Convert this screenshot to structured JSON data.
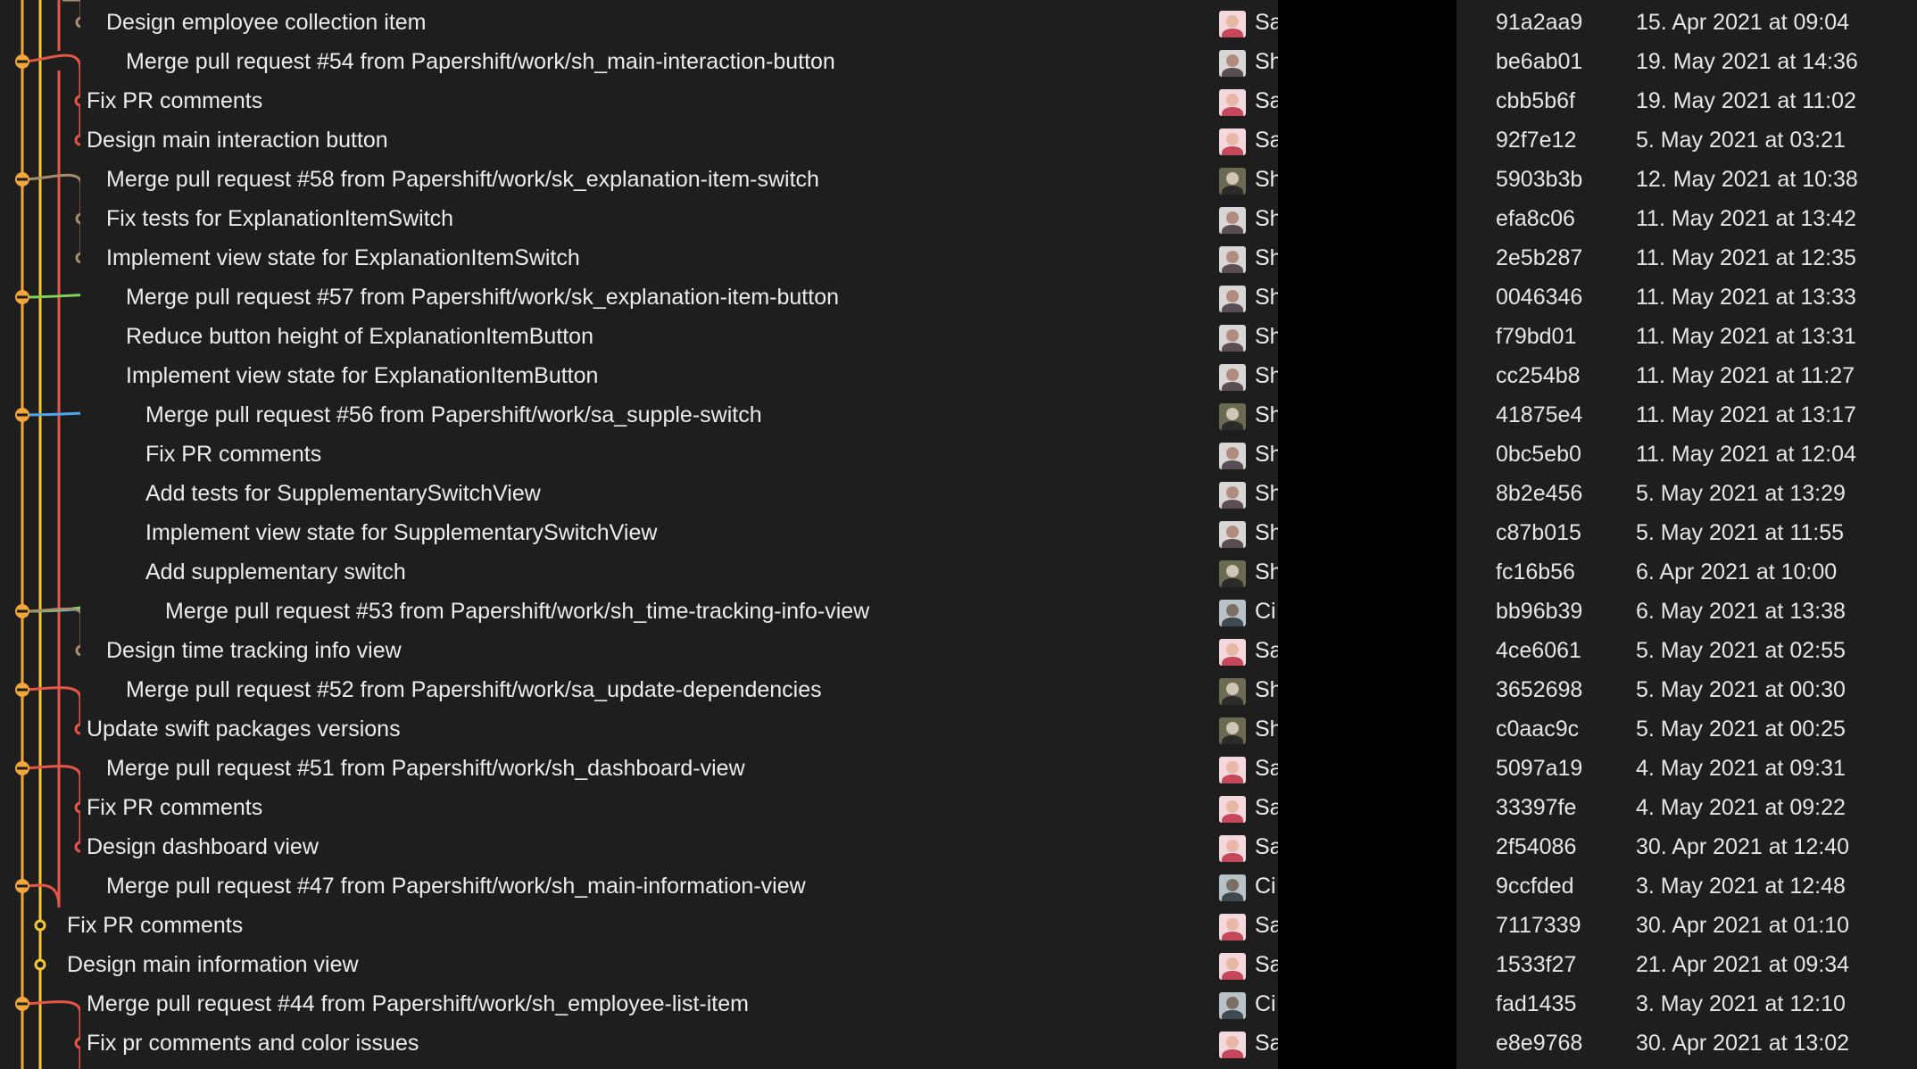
{
  "colors": {
    "background": "#1e1e1e",
    "main_branch": "#f5a63a",
    "lane_yellow": "#f3c833",
    "lane_red": "#e85445",
    "lane_tan": "#a88c6c",
    "lane_green": "#7fd55a",
    "lane_blue": "#4ea6f0"
  },
  "commits": [
    {
      "message": "Design employee collection item",
      "avatar": "sa",
      "author": "Sa",
      "hash": "91a2aa9",
      "date": "15. Apr 2021 at 09:04"
    },
    {
      "message": "Merge pull request #54 from Papershift/work/sh_main-interaction-button",
      "avatar": "sh",
      "author": "Sh",
      "hash": "be6ab01",
      "date": "19. May 2021 at 14:36"
    },
    {
      "message": "Fix PR comments",
      "avatar": "sa",
      "author": "Sa",
      "hash": "cbb5b6f",
      "date": "19. May 2021 at 11:02"
    },
    {
      "message": "Design main interaction button",
      "avatar": "sa",
      "author": "Sa",
      "hash": "92f7e12",
      "date": "5. May 2021 at 03:21"
    },
    {
      "message": "Merge pull request #58 from Papershift/work/sk_explanation-item-switch",
      "avatar": "sh2",
      "author": "Sh",
      "hash": "5903b3b",
      "date": "12. May 2021 at 10:38"
    },
    {
      "message": "Fix tests for ExplanationItemSwitch",
      "avatar": "sh",
      "author": "Sh",
      "hash": "efa8c06",
      "date": "11. May 2021 at 13:42"
    },
    {
      "message": "Implement view state for ExplanationItemSwitch",
      "avatar": "sh",
      "author": "Sh",
      "hash": "2e5b287",
      "date": "11. May 2021 at 12:35"
    },
    {
      "message": "Merge pull request #57 from Papershift/work/sk_explanation-item-button",
      "avatar": "sh",
      "author": "Sh",
      "hash": "0046346",
      "date": "11. May 2021 at 13:33"
    },
    {
      "message": "Reduce button height of ExplanationItemButton",
      "avatar": "sh",
      "author": "Sh",
      "hash": "f79bd01",
      "date": "11. May 2021 at 13:31"
    },
    {
      "message": "Implement view state for ExplanationItemButton",
      "avatar": "sh",
      "author": "Sh",
      "hash": "cc254b8",
      "date": "11. May 2021 at 11:27"
    },
    {
      "message": "Merge pull request #56 from Papershift/work/sa_supple-switch",
      "avatar": "sh2",
      "author": "Sh",
      "hash": "41875e4",
      "date": "11. May 2021 at 13:17"
    },
    {
      "message": "Fix PR comments",
      "avatar": "sh",
      "author": "Sh",
      "hash": "0bc5eb0",
      "date": "11. May 2021 at 12:04"
    },
    {
      "message": "Add tests for SupplementarySwitchView",
      "avatar": "sh",
      "author": "Sh",
      "hash": "8b2e456",
      "date": "5. May 2021 at 13:29"
    },
    {
      "message": "Implement view state for SupplementarySwitchView",
      "avatar": "sh",
      "author": "Sh",
      "hash": "c87b015",
      "date": "5. May 2021 at 11:55"
    },
    {
      "message": "Add supplementary switch",
      "avatar": "sh2",
      "author": "Sh",
      "hash": "fc16b56",
      "date": "6. Apr 2021 at 10:00"
    },
    {
      "message": "Merge pull request #53 from Papershift/work/sh_time-tracking-info-view",
      "avatar": "ci",
      "author": "Ci",
      "hash": "bb96b39",
      "date": "6. May 2021 at 13:38"
    },
    {
      "message": "Design time tracking info view",
      "avatar": "sa",
      "author": "Sa",
      "hash": "4ce6061",
      "date": "5. May 2021 at 02:55"
    },
    {
      "message": "Merge pull request #52 from Papershift/work/sa_update-dependencies",
      "avatar": "sh2",
      "author": "Sh",
      "hash": "3652698",
      "date": "5. May 2021 at 00:30"
    },
    {
      "message": "Update swift packages versions",
      "avatar": "sh2",
      "author": "Sh",
      "hash": "c0aac9c",
      "date": "5. May 2021 at 00:25"
    },
    {
      "message": "Merge pull request #51 from Papershift/work/sh_dashboard-view",
      "avatar": "sa",
      "author": "Sa",
      "hash": "5097a19",
      "date": "4. May 2021 at 09:31"
    },
    {
      "message": "Fix PR comments",
      "avatar": "sa",
      "author": "Sa",
      "hash": "33397fe",
      "date": "4. May 2021 at 09:22"
    },
    {
      "message": "Design dashboard view",
      "avatar": "sa",
      "author": "Sa",
      "hash": "2f54086",
      "date": "30. Apr 2021 at 12:40"
    },
    {
      "message": "Merge pull request #47 from Papershift/work/sh_main-information-view",
      "avatar": "ci",
      "author": "Ci",
      "hash": "9ccfded",
      "date": "3. May 2021 at 12:48"
    },
    {
      "message": "Fix PR comments",
      "avatar": "sa",
      "author": "Sa",
      "hash": "7117339",
      "date": "30. Apr 2021 at 01:10"
    },
    {
      "message": "Design main information view",
      "avatar": "sa",
      "author": "Sa",
      "hash": "1533f27",
      "date": "21. Apr 2021 at 09:34"
    },
    {
      "message": "Merge pull request #44 from Papershift/work/sh_employee-list-item",
      "avatar": "ci",
      "author": "Ci",
      "hash": "fad1435",
      "date": "3. May 2021 at 12:10"
    },
    {
      "message": "Fix pr comments and color issues",
      "avatar": "sa",
      "author": "Sa",
      "hash": "e8e9768",
      "date": "30. Apr 2021 at 13:02"
    }
  ]
}
